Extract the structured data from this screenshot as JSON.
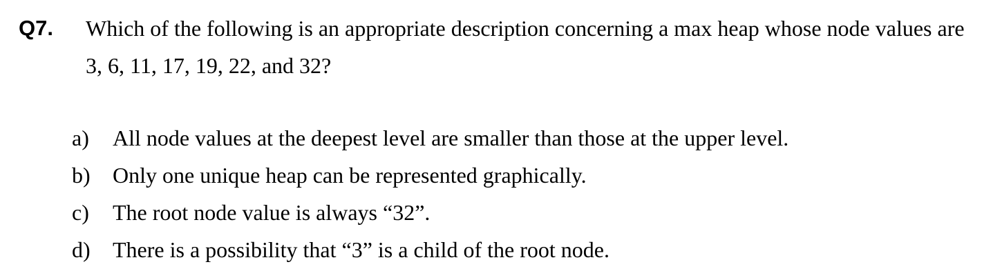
{
  "question": {
    "number": "Q7.",
    "text": "Which of the following is an appropriate description concerning a max heap whose node values are 3, 6, 11, 17, 19, 22, and 32?"
  },
  "options": [
    {
      "letter": "a)",
      "text": "All node values at the deepest level are smaller than those at the upper level."
    },
    {
      "letter": "b)",
      "text": "Only one unique heap can be represented graphically."
    },
    {
      "letter": "c)",
      "text": "The root node value is always “32”."
    },
    {
      "letter": "d)",
      "text": "There is a possibility that “3” is a child of the root node."
    }
  ]
}
